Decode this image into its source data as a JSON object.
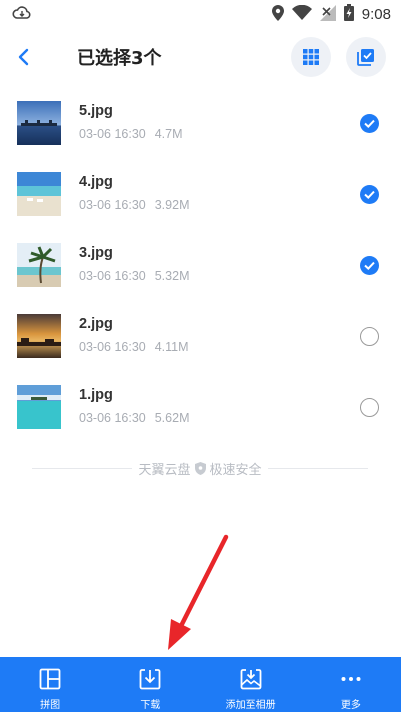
{
  "status_bar": {
    "time": "9:08",
    "icons": [
      "cloud-download-icon",
      "location-icon",
      "wifi-icon",
      "no-signal-icon",
      "battery-charging-icon"
    ]
  },
  "header": {
    "title": "已选择3个",
    "back_icon": "back-arrow-icon",
    "grid_icon": "grid-view-icon",
    "select_all_icon": "select-all-icon"
  },
  "files": [
    {
      "name": "5.jpg",
      "date": "03-06 16:30",
      "size": "4.7M",
      "selected": true
    },
    {
      "name": "4.jpg",
      "date": "03-06 16:30",
      "size": "3.92M",
      "selected": true
    },
    {
      "name": "3.jpg",
      "date": "03-06 16:30",
      "size": "5.32M",
      "selected": true
    },
    {
      "name": "2.jpg",
      "date": "03-06 16:30",
      "size": "4.11M",
      "selected": false
    },
    {
      "name": "1.jpg",
      "date": "03-06 16:30",
      "size": "5.62M",
      "selected": false
    }
  ],
  "footer": {
    "brand": "天翼云盘",
    "slogan": "极速安全"
  },
  "bottom_bar": {
    "items": [
      {
        "label": "拼图",
        "icon": "collage-icon"
      },
      {
        "label": "下载",
        "icon": "download-icon"
      },
      {
        "label": "添加至相册",
        "icon": "add-to-album-icon"
      },
      {
        "label": "更多",
        "icon": "more-icon"
      }
    ]
  },
  "colors": {
    "accent": "#1e7bf6",
    "annotation_arrow": "#e8262a"
  }
}
